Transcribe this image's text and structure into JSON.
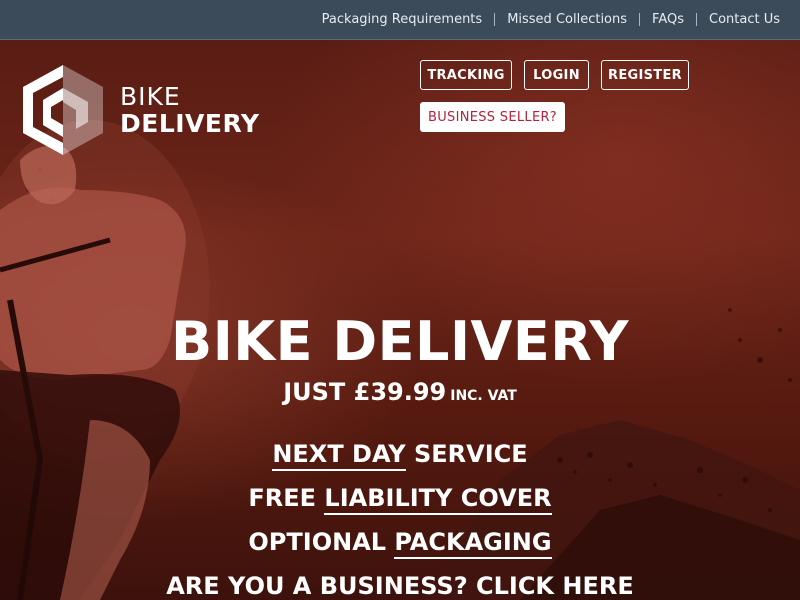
{
  "topnav": {
    "links": [
      "Packaging Requirements",
      "Missed Collections",
      "FAQs",
      "Contact Us"
    ]
  },
  "logo": {
    "line1": "BIKE",
    "line2": "DELIVERY"
  },
  "header_buttons": {
    "tracking": "TRACKING",
    "login": "LOGIN",
    "register": "REGISTER",
    "business_seller": "BUSINESS SELLER?"
  },
  "hero": {
    "title": "BIKE DELIVERY",
    "price_prefix": "JUST £39.99",
    "price_suffix": "INC. VAT",
    "features": [
      {
        "link": "NEXT DAY",
        "text": " SERVICE"
      },
      {
        "text": "FREE ",
        "link": "LIABILITY COVER"
      },
      {
        "text": "OPTIONAL ",
        "link": "PACKAGING"
      },
      {
        "text": "ARE YOU A BUSINESS? ",
        "link": "CLICK HERE"
      }
    ]
  },
  "colors": {
    "topbar": "#3b4b5a",
    "hero_base": "#5a1d14",
    "accent": "#b1243b",
    "text": "#ffffff"
  }
}
